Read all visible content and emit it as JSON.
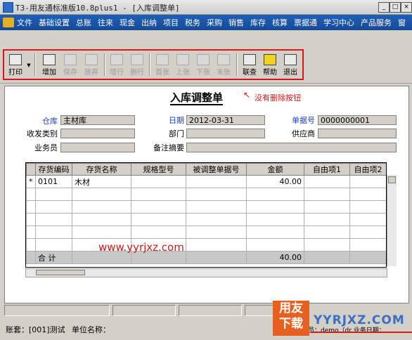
{
  "window": {
    "title": "T3-用友通标准版10.8plus1 - [入库调整单]",
    "min": "_",
    "max": "□",
    "close": "×"
  },
  "menu": [
    "文件",
    "基础设置",
    "总账",
    "往来",
    "现金",
    "出纳",
    "项目",
    "税务",
    "采购",
    "销售",
    "库存",
    "核算",
    "票据通",
    "学习中心",
    "产品服务",
    "窗"
  ],
  "toolbar": {
    "print": "打印",
    "add": "增加",
    "save": "保存",
    "discard": "放弃",
    "add_row": "增行",
    "delete_row": "删行",
    "first": "首张",
    "prev": "上张",
    "next": "下张",
    "last": "末张",
    "linked_query": "联查",
    "help": "帮助",
    "exit": "退出"
  },
  "document": {
    "title": "入库调整单",
    "annotation": "没有删除按钮",
    "warehouse_label": "仓库",
    "warehouse": "主材库",
    "date_label": "日期",
    "date": "2012-03-31",
    "doc_no_label": "单据号",
    "doc_no": "0000000001",
    "category_label": "收发类别",
    "category": "",
    "dept_label": "部门",
    "dept": "",
    "supplier_label": "供应商",
    "supplier": "",
    "salesman_label": "业务员",
    "salesman": "",
    "remark_label": "备注摘要",
    "remark": ""
  },
  "grid": {
    "headers": [
      "存货编码",
      "存货名称",
      "规格型号",
      "被调整单据号",
      "金额",
      "自由项1",
      "自由项2"
    ],
    "rows": [
      {
        "marker": "*",
        "code": "0101",
        "name": "木材",
        "spec": "",
        "ref": "",
        "amount": "40.00",
        "f1": "",
        "f2": ""
      }
    ],
    "total_label": "合  计",
    "total_amount": "40.00"
  },
  "watermark": "www.yyrjxz.com",
  "status": {
    "account": "账套：[001]测试",
    "unit": "单位名称：",
    "operator": "操作员：demo（dr  业务日期："
  },
  "logo": {
    "line1": "用友",
    "line2": "下载",
    "brand": "YYRJXZ.COM"
  }
}
